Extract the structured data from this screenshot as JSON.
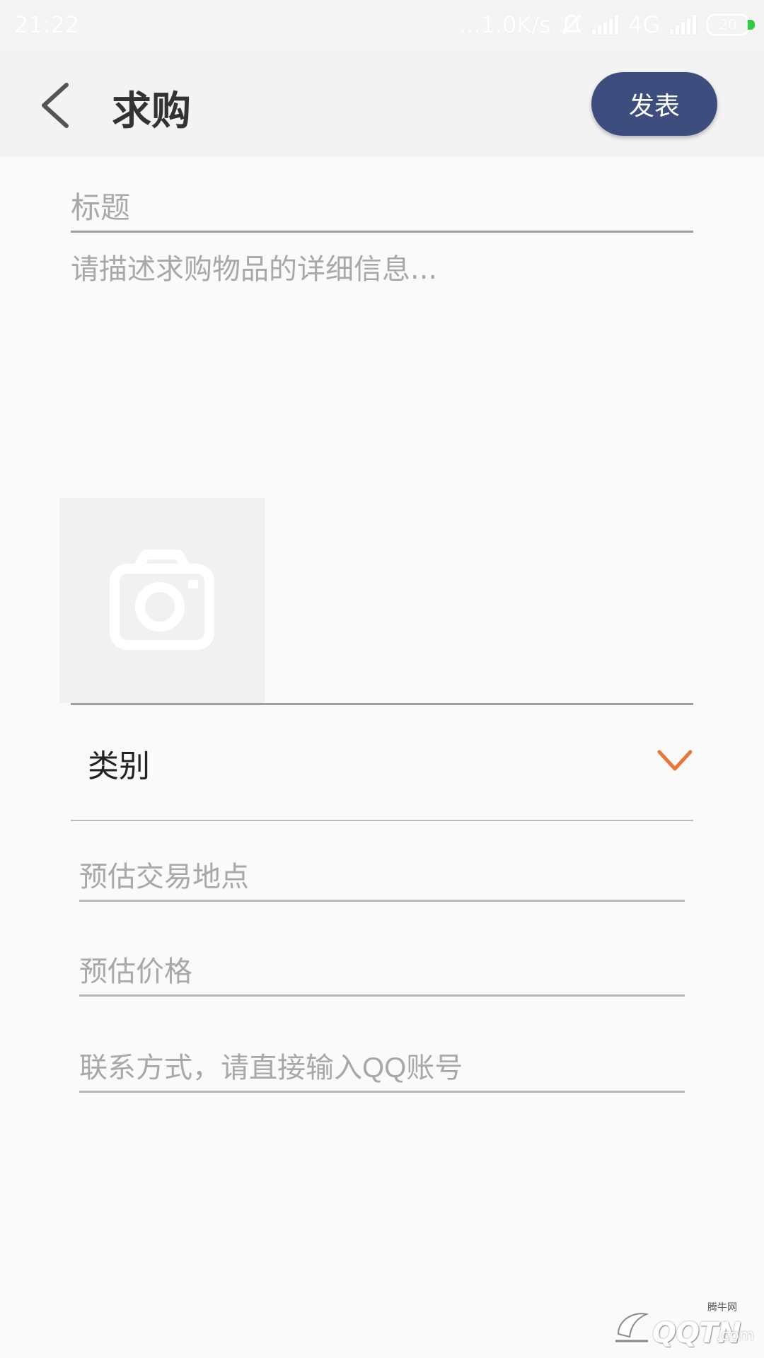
{
  "status_bar": {
    "time": "21:22",
    "net_speed": "...1.0K/s",
    "network_type": "4G",
    "battery_level": "20"
  },
  "app_bar": {
    "title": "求购",
    "publish_label": "发表"
  },
  "form": {
    "title_placeholder": "标题",
    "description_placeholder": "请描述求购物品的详细信息...",
    "category_label": "类别",
    "location_placeholder": "预估交易地点",
    "price_placeholder": "预估价格",
    "contact_placeholder": "联系方式，请直接输入QQ账号"
  },
  "icons": {
    "back": "chevron-left-icon",
    "camera": "camera-icon",
    "dropdown": "chevron-down-icon",
    "mute": "bell-off-icon"
  },
  "colors": {
    "accent_button": "#3d4d7e",
    "chevron": "#e8773a",
    "battery_tip": "#2ecc40"
  },
  "watermark": {
    "brand": "QQTN",
    "small_text": "腾牛网",
    "suffix": ".com"
  }
}
